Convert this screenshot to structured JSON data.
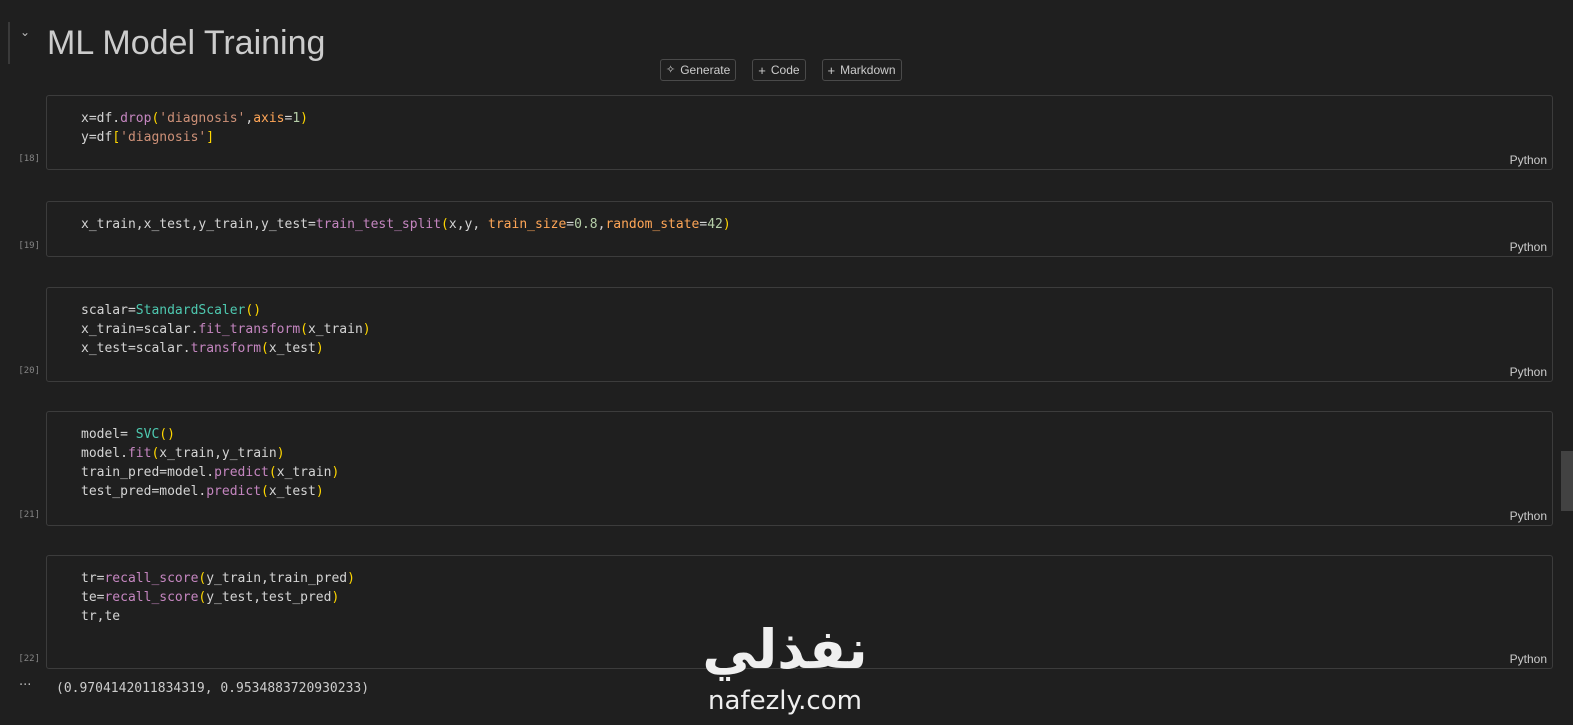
{
  "markdown_title": "ML Model Training",
  "toolbar": {
    "generate_label": "Generate",
    "code_label": "Code",
    "markdown_label": "Markdown"
  },
  "cells": [
    {
      "exec_count": "[18]",
      "language": "Python",
      "lines": [
        "x=df.drop('diagnosis',axis=1)",
        "y=df['diagnosis']"
      ]
    },
    {
      "exec_count": "[19]",
      "language": "Python",
      "lines": [
        "x_train,x_test,y_train,y_test=train_test_split(x,y, train_size=0.8,random_state=42)"
      ]
    },
    {
      "exec_count": "[20]",
      "language": "Python",
      "lines": [
        "scalar=StandardScaler()",
        "x_train=scalar.fit_transform(x_train)",
        "x_test=scalar.transform(x_test)"
      ]
    },
    {
      "exec_count": "[21]",
      "language": "Python",
      "lines": [
        "model= SVC()",
        "model.fit(x_train,y_train)",
        "train_pred=model.predict(x_train)",
        "test_pred=model.predict(x_test)"
      ]
    },
    {
      "exec_count": "[22]",
      "language": "Python",
      "lines": [
        "tr=recall_score(y_train,train_pred)",
        "te=recall_score(y_test,test_pred)",
        "tr,te"
      ]
    }
  ],
  "output": {
    "dots": "···",
    "text": "(0.9704142011834319, 0.9534883720930233)"
  },
  "watermark": {
    "arabic": "نفذلي",
    "latin": "nafezly.com"
  }
}
